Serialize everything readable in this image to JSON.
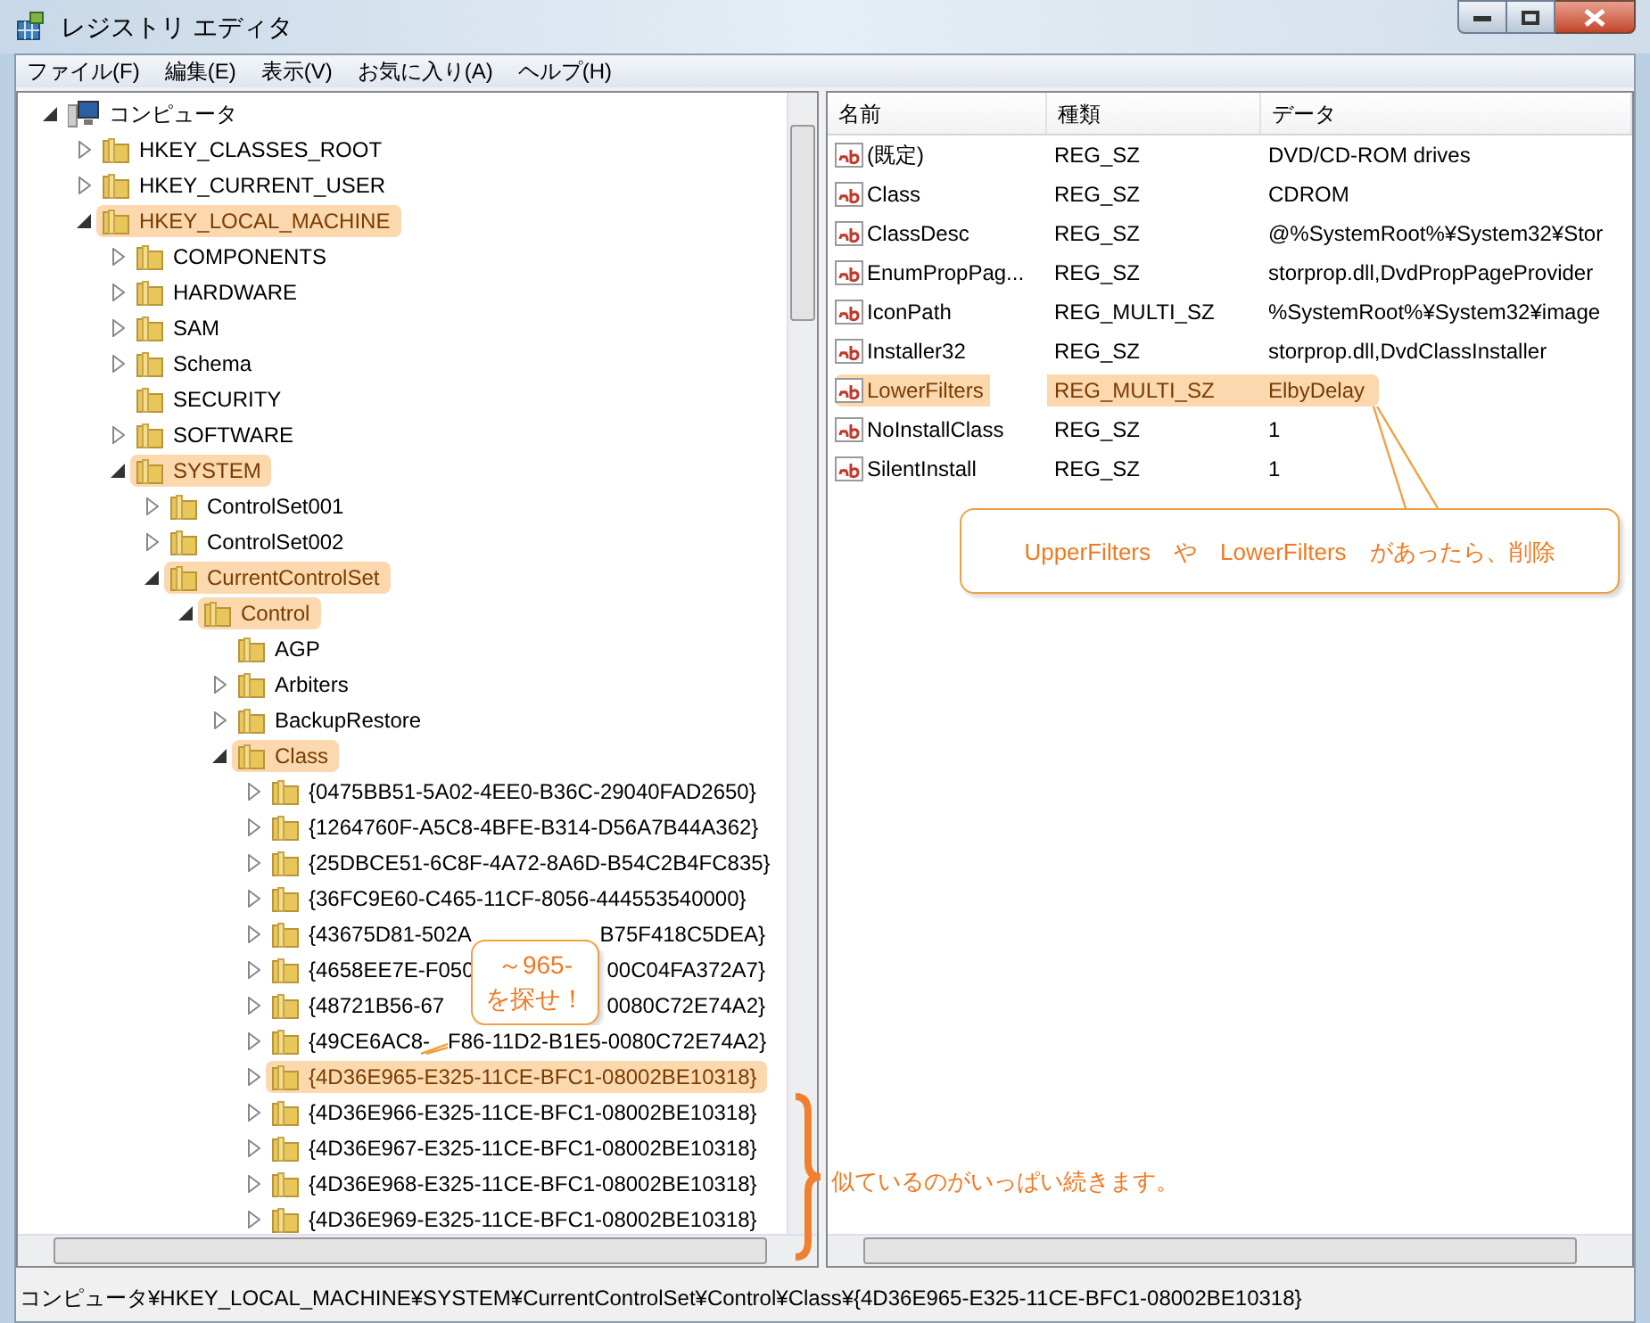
{
  "window": {
    "title": "レジストリ エディタ"
  },
  "menu": [
    "ファイル(F)",
    "編集(E)",
    "表示(V)",
    "お気に入り(A)",
    "ヘルプ(H)"
  ],
  "tree": {
    "label": "コンピュータ",
    "kind": "computer",
    "expanded": true,
    "highlighted": false,
    "children": [
      {
        "label": "HKEY_CLASSES_ROOT",
        "kind": "folder",
        "expanded": false,
        "highlighted": false
      },
      {
        "label": "HKEY_CURRENT_USER",
        "kind": "folder",
        "expanded": false,
        "highlighted": false
      },
      {
        "label": "HKEY_LOCAL_MACHINE",
        "kind": "folder",
        "expanded": true,
        "highlighted": true,
        "children": [
          {
            "label": "COMPONENTS",
            "kind": "folder",
            "expanded": false,
            "highlighted": false
          },
          {
            "label": "HARDWARE",
            "kind": "folder",
            "expanded": false,
            "highlighted": false
          },
          {
            "label": "SAM",
            "kind": "folder",
            "expanded": false,
            "highlighted": false
          },
          {
            "label": "Schema",
            "kind": "folder",
            "expanded": false,
            "highlighted": false
          },
          {
            "label": "SECURITY",
            "kind": "leaf",
            "highlighted": false
          },
          {
            "label": "SOFTWARE",
            "kind": "folder",
            "expanded": false,
            "highlighted": false
          },
          {
            "label": "SYSTEM",
            "kind": "folder",
            "expanded": true,
            "highlighted": true,
            "children": [
              {
                "label": "ControlSet001",
                "kind": "folder",
                "expanded": false,
                "highlighted": false
              },
              {
                "label": "ControlSet002",
                "kind": "folder",
                "expanded": false,
                "highlighted": false
              },
              {
                "label": "CurrentControlSet",
                "kind": "folder",
                "expanded": true,
                "highlighted": true,
                "children": [
                  {
                    "label": "Control",
                    "kind": "folder",
                    "expanded": true,
                    "highlighted": true,
                    "children": [
                      {
                        "label": "AGP",
                        "kind": "leaf",
                        "highlighted": false
                      },
                      {
                        "label": "Arbiters",
                        "kind": "folder",
                        "expanded": false,
                        "highlighted": false
                      },
                      {
                        "label": "BackupRestore",
                        "kind": "folder",
                        "expanded": false,
                        "highlighted": false
                      },
                      {
                        "label": "Class",
                        "kind": "folder",
                        "expanded": true,
                        "highlighted": true,
                        "children": [
                          {
                            "label": "{0475BB51-5A02-4EE0-B36C-29040FAD2650}",
                            "kind": "folder",
                            "expanded": false,
                            "highlighted": false
                          },
                          {
                            "label": "{1264760F-A5C8-4BFE-B314-D56A7B44A362}",
                            "kind": "folder",
                            "expanded": false,
                            "highlighted": false
                          },
                          {
                            "label": "{25DBCE51-6C8F-4A72-8A6D-B54C2B4FC835}",
                            "kind": "folder",
                            "expanded": false,
                            "highlighted": false
                          },
                          {
                            "label": "{36FC9E60-C465-11CF-8056-444553540000}",
                            "kind": "folder",
                            "expanded": false,
                            "highlighted": false
                          },
                          {
                            "label": "{43675D81-502A",
                            "label_end": "B75F418C5DEA}",
                            "kind": "folder",
                            "expanded": false,
                            "highlighted": false
                          },
                          {
                            "label": "{4658EE7E-F050",
                            "label_end": "00C04FA372A7}",
                            "kind": "folder",
                            "expanded": false,
                            "highlighted": false
                          },
                          {
                            "label": "{48721B56-67",
                            "label_end": "0080C72E74A2}",
                            "kind": "folder",
                            "expanded": false,
                            "highlighted": false
                          },
                          {
                            "label": "{49CE6AC8-",
                            "label_end": "F86-11D2-B1E5-0080C72E74A2}",
                            "kind": "folder",
                            "expanded": false,
                            "highlighted": false
                          },
                          {
                            "label": "{4D36E965-E325-11CE-BFC1-08002BE10318}",
                            "kind": "folder",
                            "expanded": false,
                            "highlighted": true
                          },
                          {
                            "label": "{4D36E966-E325-11CE-BFC1-08002BE10318}",
                            "kind": "folder",
                            "expanded": false,
                            "highlighted": false
                          },
                          {
                            "label": "{4D36E967-E325-11CE-BFC1-08002BE10318}",
                            "kind": "folder",
                            "expanded": false,
                            "highlighted": false
                          },
                          {
                            "label": "{4D36E968-E325-11CE-BFC1-08002BE10318}",
                            "kind": "folder",
                            "expanded": false,
                            "highlighted": false
                          },
                          {
                            "label": "{4D36E969-E325-11CE-BFC1-08002BE10318}",
                            "kind": "folder",
                            "expanded": false,
                            "highlighted": false
                          }
                        ]
                      }
                    ]
                  }
                ]
              }
            ]
          }
        ]
      }
    ]
  },
  "values": {
    "columns": [
      "名前",
      "種類",
      "データ"
    ],
    "rows": [
      {
        "name": "(既定)",
        "type": "REG_SZ",
        "data": "DVD/CD-ROM drives",
        "highlighted": false
      },
      {
        "name": "Class",
        "type": "REG_SZ",
        "data": "CDROM",
        "highlighted": false
      },
      {
        "name": "ClassDesc",
        "type": "REG_SZ",
        "data": "@%SystemRoot%¥System32¥Stor",
        "highlighted": false
      },
      {
        "name": "EnumPropPag...",
        "type": "REG_SZ",
        "data": "storprop.dll,DvdPropPageProvider",
        "highlighted": false
      },
      {
        "name": "IconPath",
        "type": "REG_MULTI_SZ",
        "data": "%SystemRoot%¥System32¥image",
        "highlighted": false
      },
      {
        "name": "Installer32",
        "type": "REG_SZ",
        "data": "storprop.dll,DvdClassInstaller",
        "highlighted": false
      },
      {
        "name": "LowerFilters",
        "type": "REG_MULTI_SZ",
        "data": "ElbyDelay",
        "highlighted": true
      },
      {
        "name": "NoInstallClass",
        "type": "REG_SZ",
        "data": "1",
        "highlighted": false
      },
      {
        "name": "SilentInstall",
        "type": "REG_SZ",
        "data": "1",
        "highlighted": false
      }
    ]
  },
  "callouts": [
    {
      "kind": "box",
      "lines": [
        "～965-",
        "を探せ！"
      ]
    },
    {
      "kind": "box",
      "lines": [
        "UpperFilters　や　LowerFilters　があったら、削除"
      ]
    },
    {
      "kind": "brace",
      "lines": [
        "似ているのがいっぱい続きます。"
      ]
    }
  ],
  "status_bar": "コンピュータ¥HKEY_LOCAL_MACHINE¥SYSTEM¥CurrentControlSet¥Control¥Class¥{4D36E965-E325-11CE-BFC1-08002BE10318}"
}
